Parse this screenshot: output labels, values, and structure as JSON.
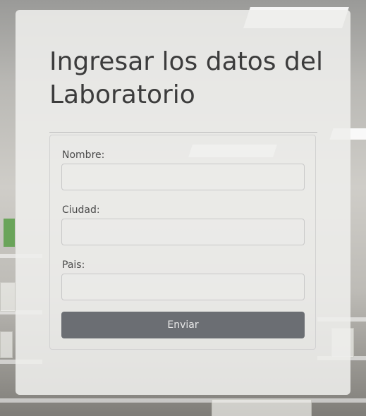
{
  "form": {
    "title": "Ingresar los datos del Laboratorio",
    "fields": [
      {
        "label": "Nombre:",
        "value": ""
      },
      {
        "label": "Ciudad:",
        "value": ""
      },
      {
        "label": "Pais:",
        "value": ""
      }
    ],
    "submit_label": "Enviar"
  },
  "colors": {
    "button_bg": "#6b6e73",
    "card_bg": "#eeeeec",
    "title_text": "#3c3c3c"
  }
}
